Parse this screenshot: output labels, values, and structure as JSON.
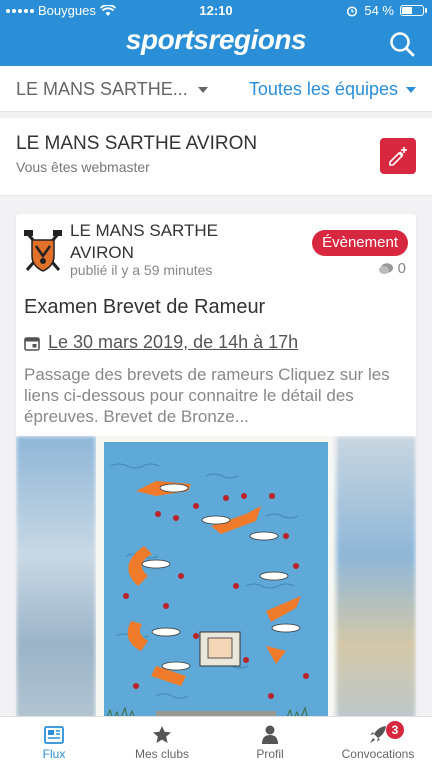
{
  "status_bar": {
    "carrier": "Bouygues",
    "time": "12:10",
    "battery": "54 %",
    "battery_level": 0.54
  },
  "header": {
    "brand": "sportsregions",
    "search_icon": "search-icon",
    "color": "#2a8fd6"
  },
  "filters": {
    "club_select": "LE MANS SARTHE...",
    "team_select": "Toutes les équipes"
  },
  "club_header": {
    "name": "LE MANS SARTHE AVIRON",
    "role": "Vous êtes webmaster",
    "edit_icon": "edit-add-icon"
  },
  "post": {
    "author": "LE MANS SARTHE AVIRON",
    "published": "publié il y a 59 minutes",
    "badge": "Évènement",
    "comment_count": "0",
    "title": "Examen Brevet de Rameur",
    "date": "Le 30 mars 2019, de 14h à 17h",
    "excerpt": "Passage des brevets de rameurs Cliquez sur les liens ci-dessous pour connaitre le détail des épreuves.  Brevet de Bronze..."
  },
  "tabbar": {
    "tabs": [
      {
        "label": "Flux",
        "icon": "newspaper-icon",
        "active": true
      },
      {
        "label": "Mes clubs",
        "icon": "star-icon",
        "active": false
      },
      {
        "label": "Profil",
        "icon": "person-icon",
        "active": false
      },
      {
        "label": "Convocations",
        "icon": "rocket-icon",
        "active": false
      }
    ],
    "convocations_badge": "3"
  },
  "colors": {
    "primary": "#2a8fd6",
    "accent_red": "#d8283f"
  }
}
